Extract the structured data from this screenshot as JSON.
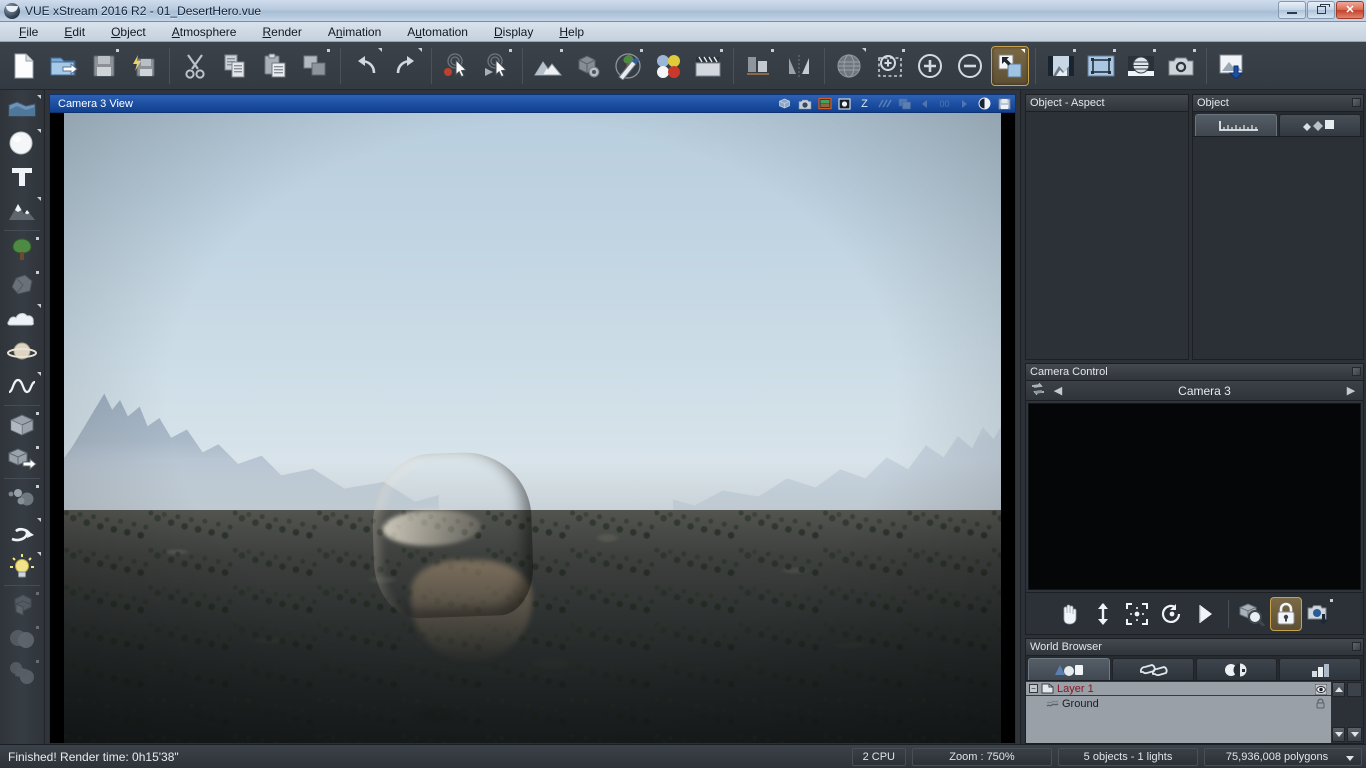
{
  "window": {
    "title": "VUE xStream 2016 R2 - 01_DesertHero.vue",
    "app_icon": "vue-logo-icon",
    "buttons": {
      "minimize": "minimize-button",
      "restore": "restore-button",
      "close": "✕"
    }
  },
  "menubar": {
    "items": [
      {
        "label": "File",
        "accel": "F"
      },
      {
        "label": "Edit",
        "accel": "E"
      },
      {
        "label": "Object",
        "accel": "O"
      },
      {
        "label": "Atmosphere",
        "accel": "A"
      },
      {
        "label": "Render",
        "accel": "R"
      },
      {
        "label": "Animation",
        "accel": "n"
      },
      {
        "label": "Automation",
        "accel": "u"
      },
      {
        "label": "Display",
        "accel": "D"
      },
      {
        "label": "Help",
        "accel": "H"
      }
    ]
  },
  "toolbar": {
    "groups": [
      {
        "buttons": [
          {
            "name": "new-file-icon",
            "label": "New",
            "flag": "none",
            "active": false
          },
          {
            "name": "open-file-icon",
            "label": "Open",
            "flag": "none",
            "active": false
          },
          {
            "name": "save-file-icon",
            "label": "Save",
            "flag": "dot",
            "active": false
          },
          {
            "name": "save-all-icon",
            "label": "Quick Save",
            "flag": "none",
            "active": false
          }
        ]
      },
      {
        "buttons": [
          {
            "name": "cut-icon",
            "label": "Cut",
            "flag": "none",
            "active": false
          },
          {
            "name": "copy-icon",
            "label": "Copy",
            "flag": "none",
            "active": false
          },
          {
            "name": "paste-icon",
            "label": "Paste",
            "flag": "none",
            "active": false
          },
          {
            "name": "duplicate-icon",
            "label": "Duplicate",
            "flag": "dot",
            "active": false
          }
        ]
      },
      {
        "buttons": [
          {
            "name": "undo-icon",
            "label": "Undo",
            "flag": "corner",
            "active": false
          },
          {
            "name": "redo-icon",
            "label": "Redo",
            "flag": "corner",
            "active": false
          }
        ]
      },
      {
        "buttons": [
          {
            "name": "record-cursor-icon",
            "label": "Record",
            "flag": "none",
            "active": false
          },
          {
            "name": "play-cursor-icon",
            "label": "Play",
            "flag": "dot",
            "active": false
          }
        ]
      },
      {
        "buttons": [
          {
            "name": "terrain-editor-icon",
            "label": "Terrain Editor",
            "flag": "dot",
            "active": false
          },
          {
            "name": "object-options-icon",
            "label": "Object Options",
            "flag": "none",
            "active": false
          },
          {
            "name": "ecosystem-paint-icon",
            "label": "EcoSystem Paint",
            "flag": "dot",
            "active": false
          },
          {
            "name": "material-editor-icon",
            "label": "Material Editor",
            "flag": "none",
            "active": false
          },
          {
            "name": "animation-icon",
            "label": "Animation",
            "flag": "dot",
            "active": false
          }
        ]
      },
      {
        "buttons": [
          {
            "name": "align-icon",
            "label": "Align",
            "flag": "dot",
            "active": false
          },
          {
            "name": "mirror-icon",
            "label": "Mirror",
            "flag": "none",
            "active": false
          }
        ]
      },
      {
        "buttons": [
          {
            "name": "atmosphere-globe-icon",
            "label": "Atmosphere",
            "flag": "corner",
            "active": false
          },
          {
            "name": "zoom-selection-icon",
            "label": "Zoom to Selection",
            "flag": "dot",
            "active": false
          },
          {
            "name": "zoom-in-icon",
            "label": "Zoom In",
            "flag": "none",
            "active": false
          },
          {
            "name": "zoom-out-icon",
            "label": "Zoom Out",
            "flag": "none",
            "active": false
          },
          {
            "name": "resize-view-icon",
            "label": "Resize View",
            "flag": "corner",
            "active": true
          }
        ]
      },
      {
        "buttons": [
          {
            "name": "render-preview-icon",
            "label": "Render Preview",
            "flag": "dot",
            "active": false
          },
          {
            "name": "render-area-icon",
            "label": "Render Area",
            "flag": "dot",
            "active": false
          },
          {
            "name": "render-sphere-icon",
            "label": "Render Options",
            "flag": "dot",
            "active": false
          },
          {
            "name": "camera-render-icon",
            "label": "Render Camera",
            "flag": "dot",
            "active": false
          }
        ]
      },
      {
        "buttons": [
          {
            "name": "export-render-icon",
            "label": "Export",
            "flag": "none",
            "active": false
          }
        ]
      }
    ]
  },
  "left_rail": {
    "items": [
      {
        "name": "water-plane-icon",
        "label": "Water / Infinite Plane",
        "flag": "corner",
        "dim": false
      },
      {
        "name": "sphere-icon",
        "label": "Sphere Primitive",
        "flag": "corner",
        "dim": false
      },
      {
        "name": "text-icon",
        "label": "Text Object",
        "flag": "none",
        "dim": false
      },
      {
        "name": "terrain-icon",
        "label": "Terrain",
        "flag": "corner",
        "dim": false
      },
      {
        "name": "vegetation-icon",
        "label": "Plant",
        "flag": "dot",
        "dim": false
      },
      {
        "name": "rock-icon",
        "label": "Rock",
        "flag": "dot",
        "dim": false
      },
      {
        "name": "cloud-icon",
        "label": "Cloud Layer",
        "flag": "corner",
        "dim": false
      },
      {
        "name": "planet-icon",
        "label": "Planet",
        "flag": "none",
        "dim": false
      },
      {
        "name": "spline-icon",
        "label": "Spline / Curve",
        "flag": "corner",
        "dim": false
      },
      {
        "name": "cube-icon",
        "label": "Cube Primitive",
        "flag": "dot",
        "dim": false
      },
      {
        "name": "import-object-icon",
        "label": "Import Object",
        "flag": "dot",
        "dim": false
      },
      {
        "name": "metablob-icon",
        "label": "Metablob",
        "flag": "dot",
        "dim": false
      },
      {
        "name": "deform-icon",
        "label": "Deformation",
        "flag": "corner",
        "dim": false
      },
      {
        "name": "light-icon",
        "label": "Light Source",
        "flag": "corner",
        "dim": false
      },
      {
        "name": "boolean-group-icon",
        "label": "Group",
        "flag": "dot",
        "dim": true
      },
      {
        "name": "boolean-union-icon",
        "label": "Boolean Union",
        "flag": "dot",
        "dim": true
      },
      {
        "name": "metashape-icon",
        "label": "Boolean Difference",
        "flag": "dot",
        "dim": true
      }
    ]
  },
  "viewport": {
    "title": "Camera 3 View",
    "tools": [
      {
        "name": "view-cube-icon",
        "label": "View Cube",
        "muted": false
      },
      {
        "name": "view-camera-icon",
        "label": "Camera View",
        "muted": false
      },
      {
        "name": "display-mode-icon",
        "label": "Display Mode",
        "muted": false
      },
      {
        "name": "render-dot-icon",
        "label": "Preview Render",
        "muted": false
      },
      {
        "name": "z-axis-label",
        "label": "Z",
        "muted": false
      },
      {
        "name": "grid-icon",
        "label": "Grid",
        "muted": true
      },
      {
        "name": "layers-icon",
        "label": "Layers",
        "muted": true
      },
      {
        "name": "prev-frame-icon",
        "label": "Previous",
        "muted": true
      },
      {
        "name": "frame-counter",
        "label": "00",
        "muted": true
      },
      {
        "name": "next-frame-icon",
        "label": "Next",
        "muted": true
      },
      {
        "name": "contrast-icon",
        "label": "Contrast",
        "muted": false
      },
      {
        "name": "save-render-icon",
        "label": "Save Render",
        "muted": false
      }
    ]
  },
  "right_panels": {
    "object_aspect": {
      "title": "Object - Aspect"
    },
    "object": {
      "title": "Object",
      "tabs": [
        {
          "name": "tab-object-numerics",
          "icon": "ruler-icon",
          "selected": true
        },
        {
          "name": "tab-object-links",
          "icon": "objects-icon",
          "selected": false
        }
      ]
    },
    "camera_control": {
      "title": "Camera Control",
      "switch_icon": "camera-switch-icon",
      "prev_arrow": "◀",
      "next_arrow": "▶",
      "camera_name": "Camera 3",
      "tools": [
        {
          "name": "pan-camera-icon",
          "label": "Pan",
          "flag": "none",
          "active": false
        },
        {
          "name": "elevate-camera-icon",
          "label": "Move Vertically",
          "flag": "none",
          "active": false
        },
        {
          "name": "center-camera-icon",
          "label": "Center",
          "flag": "none",
          "active": false
        },
        {
          "name": "rotate-camera-icon",
          "label": "Rotate",
          "flag": "none",
          "active": false
        },
        {
          "name": "banking-camera-icon",
          "label": "Banking",
          "flag": "none",
          "active": false
        },
        {
          "name": "zoom-camera-icon",
          "label": "Zoom",
          "flag": "none",
          "active": false
        },
        {
          "name": "lock-camera-icon",
          "label": "Lock Camera",
          "flag": "none",
          "active": true
        },
        {
          "name": "snapshot-camera-icon",
          "label": "Camera Snapshot",
          "flag": "dot",
          "active": false
        }
      ]
    },
    "world_browser": {
      "title": "World Browser",
      "tabs": [
        {
          "name": "tab-world-objects",
          "icon": "shapes-icon",
          "selected": true
        },
        {
          "name": "tab-world-links",
          "icon": "links-icon",
          "selected": false
        },
        {
          "name": "tab-world-materials",
          "icon": "materials-icon",
          "selected": false
        },
        {
          "name": "tab-world-layers",
          "icon": "bars-icon",
          "selected": false
        }
      ],
      "tree": [
        {
          "name": "layer-row",
          "label": "Layer 1",
          "icon": "layer-icon",
          "depth": 0,
          "selected": true,
          "expander": "−",
          "right_icon": "eye-icon"
        },
        {
          "name": "object-row",
          "label": "Ground",
          "icon": "ground-icon",
          "depth": 1,
          "selected": false,
          "expander": "",
          "right_icon": "lock-icon"
        }
      ]
    }
  },
  "statusbar": {
    "message": "Finished! Render time: 0h15'38\"",
    "cells": [
      {
        "name": "cpu-count",
        "label": "2 CPU"
      },
      {
        "name": "zoom-level",
        "label": "Zoom : 750%"
      },
      {
        "name": "scene-counts",
        "label": "5 objects - 1 lights"
      },
      {
        "name": "polygon-count",
        "label": "75,936,008 polygons"
      }
    ]
  },
  "colors": {
    "accent_active": "#c8a34f",
    "viewport_titlebar": "#1d4fa3",
    "selection_red": "#8d1520",
    "panel_bg": "#2f343a"
  }
}
